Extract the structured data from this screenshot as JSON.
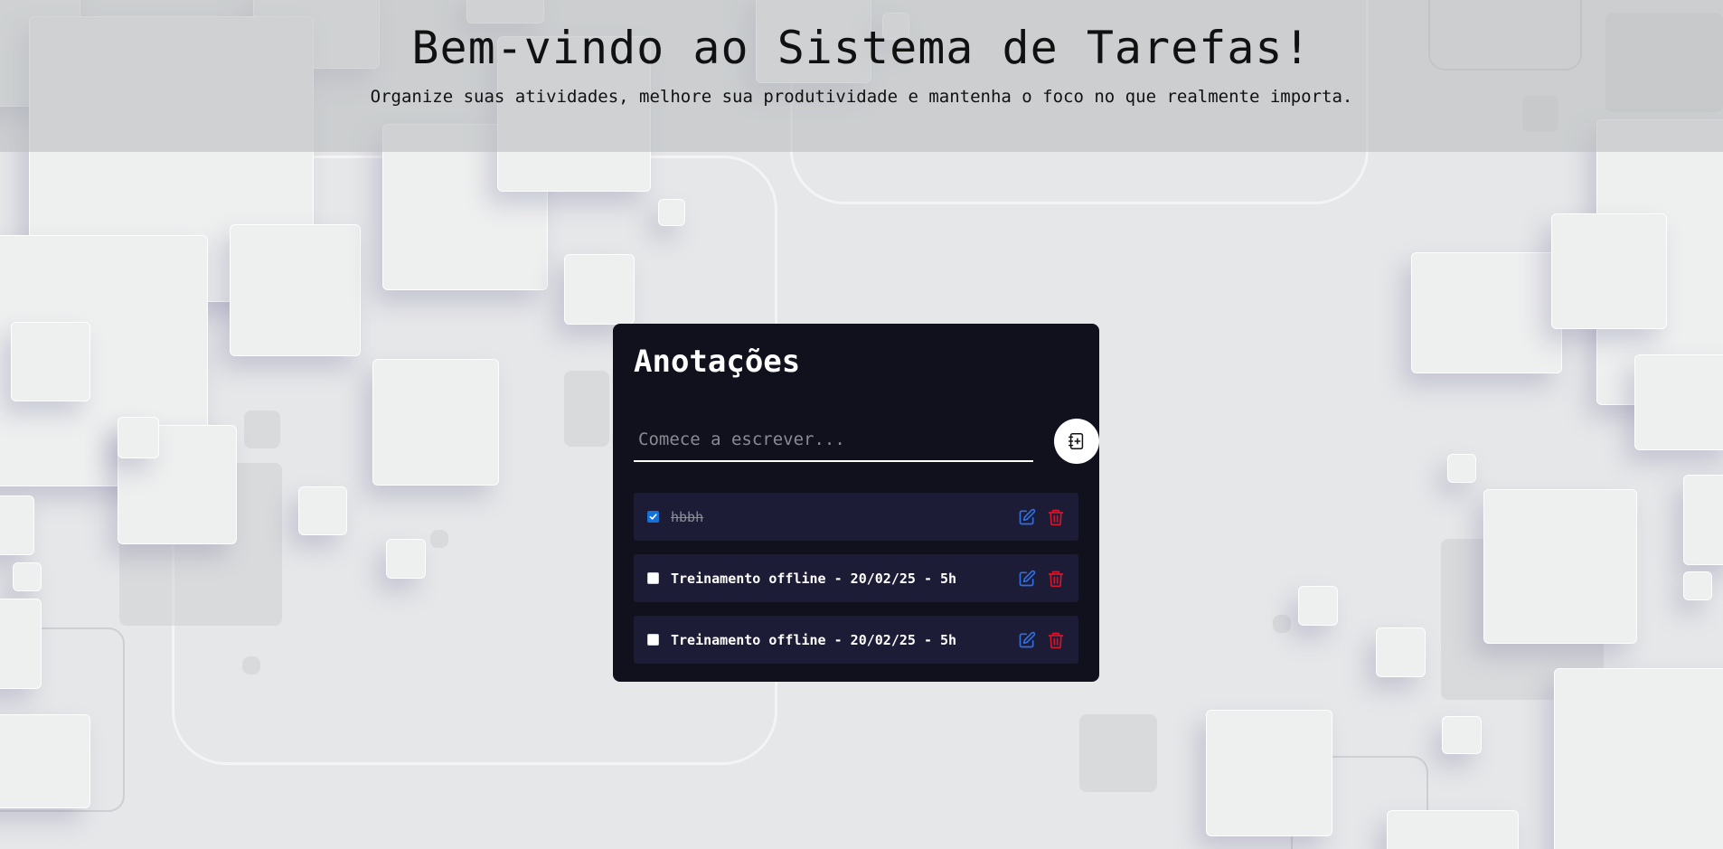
{
  "header": {
    "title": "Bem-vindo ao Sistema de Tarefas!",
    "subtitle": "Organize suas atividades, melhore sua produtividade e mantenha o foco no que realmente importa."
  },
  "card": {
    "title": "Anotações",
    "input": {
      "placeholder": "Comece a escrever...",
      "value": ""
    },
    "add_button_icon": "add-note-icon",
    "items": [
      {
        "text": "hbbh",
        "checked": true
      },
      {
        "text": "Treinamento offline - 20/02/25 - 5h",
        "checked": false
      },
      {
        "text": "Treinamento offline - 20/02/25 - 5h",
        "checked": false
      }
    ],
    "item_icons": {
      "edit": "edit-icon",
      "delete": "trash-icon"
    }
  },
  "colors": {
    "background": "#e6e7e9",
    "header_band": "#bcbec0",
    "card": "#11111d",
    "item": "#1c1c36",
    "edit_icon": "#2f6fe0",
    "delete_icon": "#d4152b",
    "checkbox_checked": "#1670d6"
  }
}
